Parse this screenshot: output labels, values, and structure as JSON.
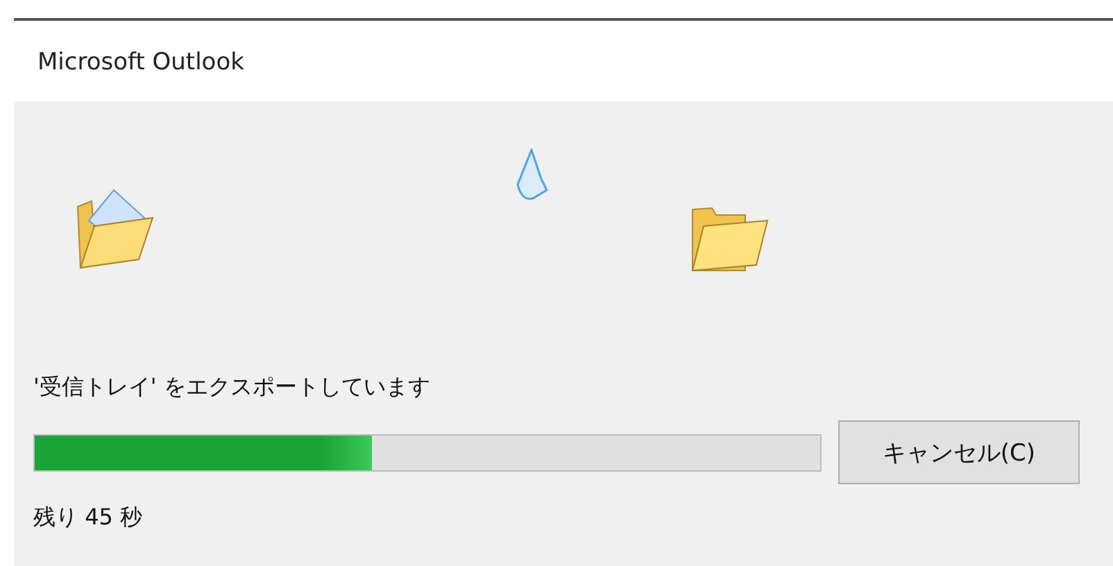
{
  "window": {
    "title": "Microsoft Outlook"
  },
  "status": {
    "message": "'受信トレイ' をエクスポートしています",
    "remaining": "残り 45 秒"
  },
  "progress": {
    "level": 0.43
  },
  "buttons": [
    {
      "label": "キャンセル(C)"
    }
  ]
}
